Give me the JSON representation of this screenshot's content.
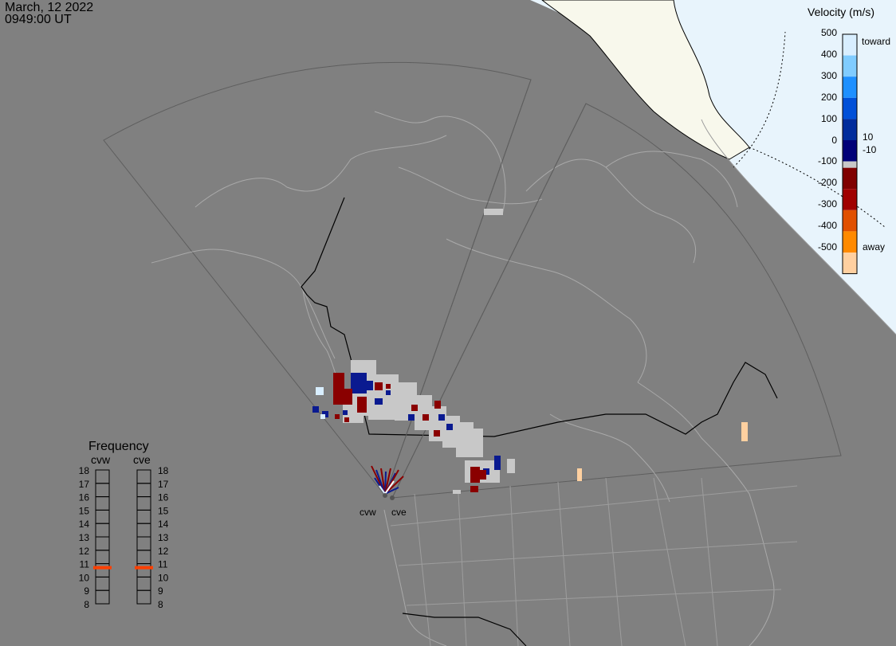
{
  "header": {
    "date": "March, 12 2022",
    "time": "0949:00 UT"
  },
  "velocity_scale": {
    "title": "Velocity (m/s)",
    "ticks": [
      "500",
      "400",
      "300",
      "200",
      "100",
      "0",
      "-100",
      "-200",
      "-300",
      "-400",
      "-500"
    ],
    "toward_label": "toward",
    "away_label": "away",
    "plus_label": "10",
    "minus_label": "-10"
  },
  "frequency_panel": {
    "title": "Frequency",
    "radar_left": "cvw",
    "radar_right": "cve",
    "levels": [
      "18",
      "17",
      "16",
      "15",
      "14",
      "13",
      "12",
      "11",
      "10",
      "9",
      "8"
    ],
    "selected_mhz_left": 10.7,
    "selected_mhz_right": 10.7
  },
  "radar_labels": {
    "west": "cvw",
    "east": "cve"
  },
  "colors": {
    "background": "#808080",
    "night_region": "#e8f4fc",
    "ice_region": "#f8f8ec",
    "ground_scatter": "#c8c8c8",
    "selected_frequency": "#ff4000",
    "toward_strong": "#0a1a90",
    "away_strong": "#8a0000",
    "away_fast": "#ffd0a0"
  }
}
